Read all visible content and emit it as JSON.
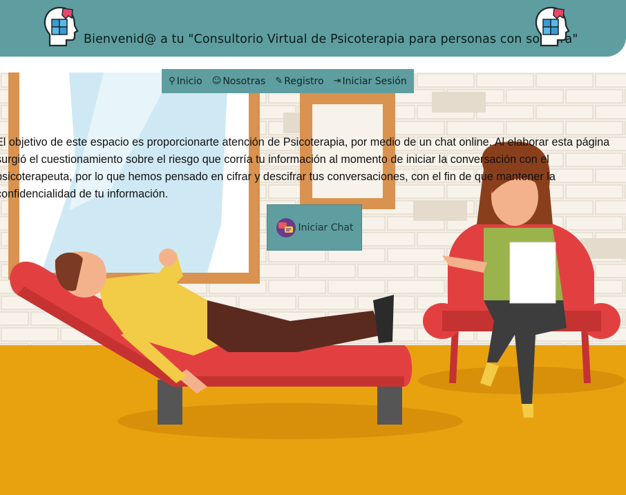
{
  "header": {
    "title": "Bienvenid@ a tu \"Consultorio Virtual de Psicoterapia para personas con sordera\"",
    "logo_icon": "head-puzzle-icon",
    "bg_color": "#5f9ea0"
  },
  "nav": {
    "items": [
      {
        "label": "Inicio",
        "icon": "home-icon"
      },
      {
        "label": "Nosotras",
        "icon": "users-icon"
      },
      {
        "label": "Registro",
        "icon": "register-icon"
      },
      {
        "label": "Iniciar Sesión",
        "icon": "login-icon"
      }
    ]
  },
  "intro": {
    "line1": "El objetivo de este espacio es proporcionarte atención de Psicoterapia, por medio de un chat online. Al elaborar esta página",
    "line2": "surgió el cuestionamiento sobre el riesgo que corría tu información al momento de iniciar la conversación con el",
    "line3": "psicoterapeuta, por lo que hemos pensado en cifrar y descifrar tus conversaciones, con el fin de que mantener la",
    "line4": "confidencialidad de tu información."
  },
  "chat_button": {
    "label": "Iniciar Chat",
    "icon": "chat-bubbles-icon"
  }
}
